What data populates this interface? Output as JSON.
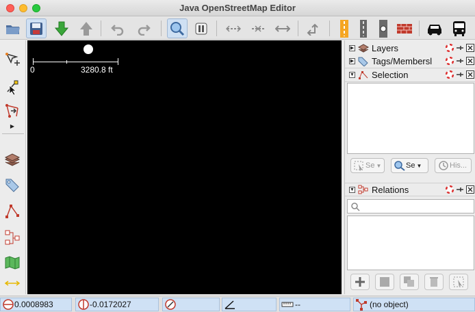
{
  "window": {
    "title": "Java OpenStreetMap Editor"
  },
  "toolbar": {
    "items": [
      "open-icon",
      "save-icon",
      "download-icon",
      "upload-icon",
      "undo-icon",
      "redo-icon",
      "zoom-icon",
      "preferences-icon",
      "split-way-icon",
      "combine-way-icon",
      "align-line-icon",
      "reverse-way-icon",
      "road-preset-icon",
      "path-preset-icon",
      "traffic-signal-preset-icon",
      "wall-preset-icon",
      "car-preset-icon",
      "bus-preset-icon"
    ]
  },
  "map": {
    "scale_start": "0",
    "scale_value": "3280.8 ft"
  },
  "panels": {
    "layers": {
      "title": "Layers"
    },
    "tags": {
      "title": "Tags/Membersl"
    },
    "selection": {
      "title": "Selection",
      "buttons": {
        "select": "Se",
        "search": "Se",
        "history": "His..."
      }
    },
    "relations": {
      "title": "Relations",
      "search_placeholder": ""
    }
  },
  "status": {
    "lat": "0.0008983",
    "lon": "-0.0172027",
    "distance": "--",
    "object": "(no object)"
  },
  "colors": {
    "accent": "#cfe1f5",
    "map_bg": "#000000"
  }
}
